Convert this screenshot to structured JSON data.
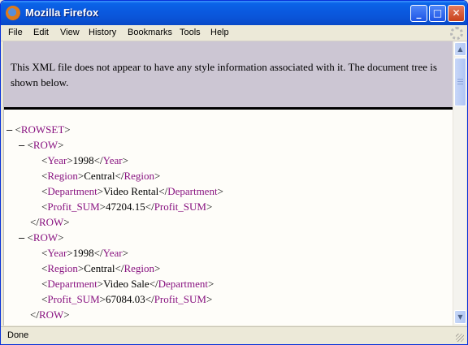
{
  "window": {
    "title": "Mozilla Firefox"
  },
  "titlebar_buttons": {
    "minimize": "_",
    "maximize": "□",
    "close": "✕"
  },
  "menu": [
    "File",
    "Edit",
    "View",
    "History",
    "Bookmarks",
    "Tools",
    "Help"
  ],
  "notice": "This XML file does not appear to have any style information associated with it. The document tree is shown below.",
  "tree": {
    "collapse_symbol": "–",
    "root_tag": "ROWSET",
    "row_tag": "ROW",
    "rows": [
      {
        "fields": [
          {
            "tag": "Year",
            "value": "1998"
          },
          {
            "tag": "Region",
            "value": "Central"
          },
          {
            "tag": "Department",
            "value": "Video Rental"
          },
          {
            "tag": "Profit_SUM",
            "value": "47204.15"
          }
        ]
      },
      {
        "fields": [
          {
            "tag": "Year",
            "value": "1998"
          },
          {
            "tag": "Region",
            "value": "Central"
          },
          {
            "tag": "Department",
            "value": "Video Sale"
          },
          {
            "tag": "Profit_SUM",
            "value": "67084.03"
          }
        ]
      }
    ]
  },
  "scrollbar": {
    "up": "▲",
    "down": "▼"
  },
  "status": "Done",
  "colors": {
    "tag": "#881280",
    "notice_bg": "#ccc6d3",
    "titlebar": "#0a54d8"
  }
}
